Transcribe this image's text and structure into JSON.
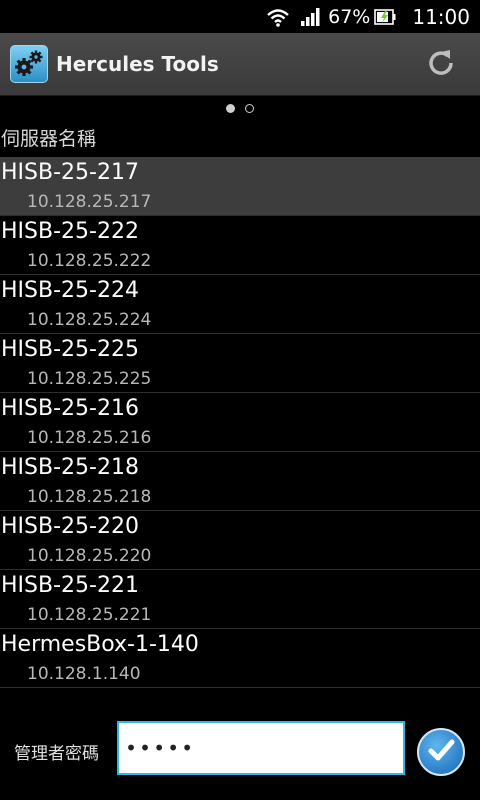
{
  "statusbar": {
    "battery_percent": "67%",
    "time": "11:00",
    "icons": [
      "wifi-icon",
      "signal-icon",
      "battery-charging-icon"
    ]
  },
  "actionbar": {
    "title": "Hercules Tools",
    "icon": "gears-app-icon",
    "refresh_icon": "refresh-icon"
  },
  "pager": {
    "pages": 2,
    "current": 1
  },
  "list": {
    "header": "伺服器名稱",
    "selected_index": 0,
    "servers": [
      {
        "name": "HISB-25-217",
        "ip": "10.128.25.217"
      },
      {
        "name": "HISB-25-222",
        "ip": "10.128.25.222"
      },
      {
        "name": "HISB-25-224",
        "ip": "10.128.25.224"
      },
      {
        "name": "HISB-25-225",
        "ip": "10.128.25.225"
      },
      {
        "name": "HISB-25-216",
        "ip": "10.128.25.216"
      },
      {
        "name": "HISB-25-218",
        "ip": "10.128.25.218"
      },
      {
        "name": "HISB-25-220",
        "ip": "10.128.25.220"
      },
      {
        "name": "HISB-25-221",
        "ip": "10.128.25.221"
      },
      {
        "name": "HermesBox-1-140",
        "ip": "10.128.1.140"
      }
    ]
  },
  "login": {
    "label": "管理者密碼",
    "password_value": "•••••",
    "confirm_icon": "checkmark-icon"
  },
  "colors": {
    "accent": "#33b5e5",
    "actionbar": "#404040",
    "selected_row": "#3d3d3d"
  }
}
